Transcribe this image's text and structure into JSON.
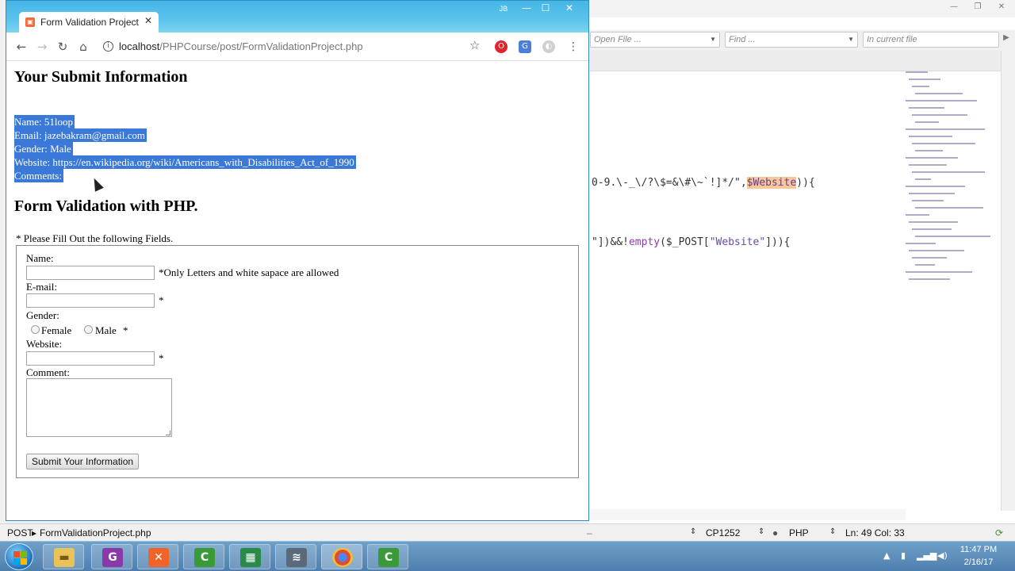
{
  "browser": {
    "tab_title": "Form Validation Project",
    "tab_close": "✕",
    "profile_badge": "JB",
    "url_host": "localhost",
    "url_path": "/PHPCourse/post/FormValidationProject.php"
  },
  "page": {
    "submit_heading": "Your Submit Information",
    "submitted": {
      "name_line": "Name: 51loop",
      "email_line": "Email: jazebakram@gmail.com",
      "gender_line": "Gender: Male",
      "website_line": "Website: https://en.wikipedia.org/wiki/Americans_with_Disabilities_Act_of_1990",
      "comments_line": "Comments:"
    },
    "form_heading": "Form Validation with PHP.",
    "fill_note": "* Please Fill Out the following Fields.",
    "form": {
      "name_label": "Name:",
      "name_value": "",
      "name_note": "*Only Letters and white sapace are allowed",
      "email_label": "E-mail:",
      "email_value": "",
      "email_required": "*",
      "gender_label": "Gender:",
      "gender_options": [
        "Female",
        "Male"
      ],
      "gender_required": "*",
      "website_label": "Website:",
      "website_value": "",
      "website_required": "*",
      "comment_label": "Comment:",
      "comment_value": "",
      "submit_label": "Submit Your Information"
    }
  },
  "editor": {
    "open_file_placeholder": "Open File ...",
    "find_placeholder": "Find ...",
    "scope_placeholder": "In current file",
    "code_line_1_pre": "0-9.\\-_\\/?\\$=&\\#\\~`!]*/\",",
    "code_line_1_var": "$Website",
    "code_line_1_post": ")){",
    "code_line_2_pre": "\"])&&!",
    "code_line_2_kw": "empty",
    "code_line_2_mid": "($_POST[",
    "code_line_2_str": "\"Website\"",
    "code_line_2_post": "])){"
  },
  "statusbar": {
    "mode": "POST",
    "file": "FormValidationProject.php",
    "encoding": "CP1252",
    "language": "PHP",
    "position": "Ln: 49 Col: 33"
  },
  "taskbar": {
    "clock_time": "11:47 PM",
    "clock_date": "2/16/17",
    "apps": [
      "file-explorer",
      "pdf-app",
      "xampp",
      "editor-green",
      "spreadsheet",
      "sublime-like",
      "chrome",
      "editor-c"
    ]
  },
  "colors": {
    "selection": "#3b79d8",
    "browser_frame": "#35a7dd",
    "taskbar": "#4f7fae"
  }
}
